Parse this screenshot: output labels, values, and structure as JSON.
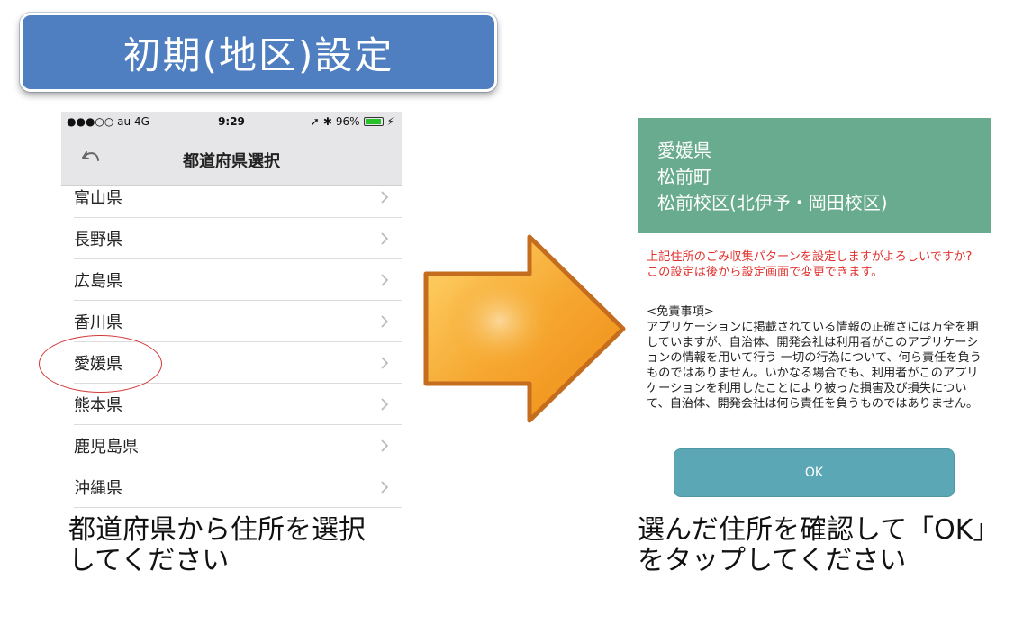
{
  "title": "初期(地区)設定",
  "phone": {
    "status": {
      "carrier": "●●●○○ au  4G",
      "time": "9:29",
      "battery": "96%",
      "battery_level": 0.96
    },
    "nav_title": "都道府県選択",
    "prefectures": [
      "富山県",
      "長野県",
      "広島県",
      "香川県",
      "愛媛県",
      "熊本県",
      "鹿児島県",
      "沖縄県"
    ],
    "highlighted": "愛媛県"
  },
  "left_caption": {
    "line1": "都道府県から住所を選択",
    "line2": "してください"
  },
  "confirm": {
    "address_lines": [
      "愛媛県",
      "松前町",
      "松前校区(北伊予・岡田校区)"
    ],
    "message": "上記住所のごみ収集パターンを設定しますがよろしいですか?\nこの設定は後から設定画面で変更できます。",
    "disclaimer": "<免責事項>\nアプリケーションに掲載されている情報の正確さには万全を期していますが、自治体、開発会社は利用者がこのアプリケーションの情報を用いて行う 一切の行為について、何ら責任を負うものではありません。いかなる場合でも、利用者がこのアプリケーションを利用したことにより被った損害及び損失について、自治体、開発会社は何ら責任を負うものではありません。",
    "ok_label": "OK"
  },
  "right_caption": {
    "line1": "選んだ住所を確認して「OK」",
    "line2": "をタップしてください"
  },
  "colors": {
    "banner": "#4f7fc0",
    "address_box": "#68ab8e",
    "warning_text": "#e0322e",
    "ok_button": "#5ba7b5",
    "arrow": "#f5a623",
    "highlight": "#d23a3a"
  }
}
